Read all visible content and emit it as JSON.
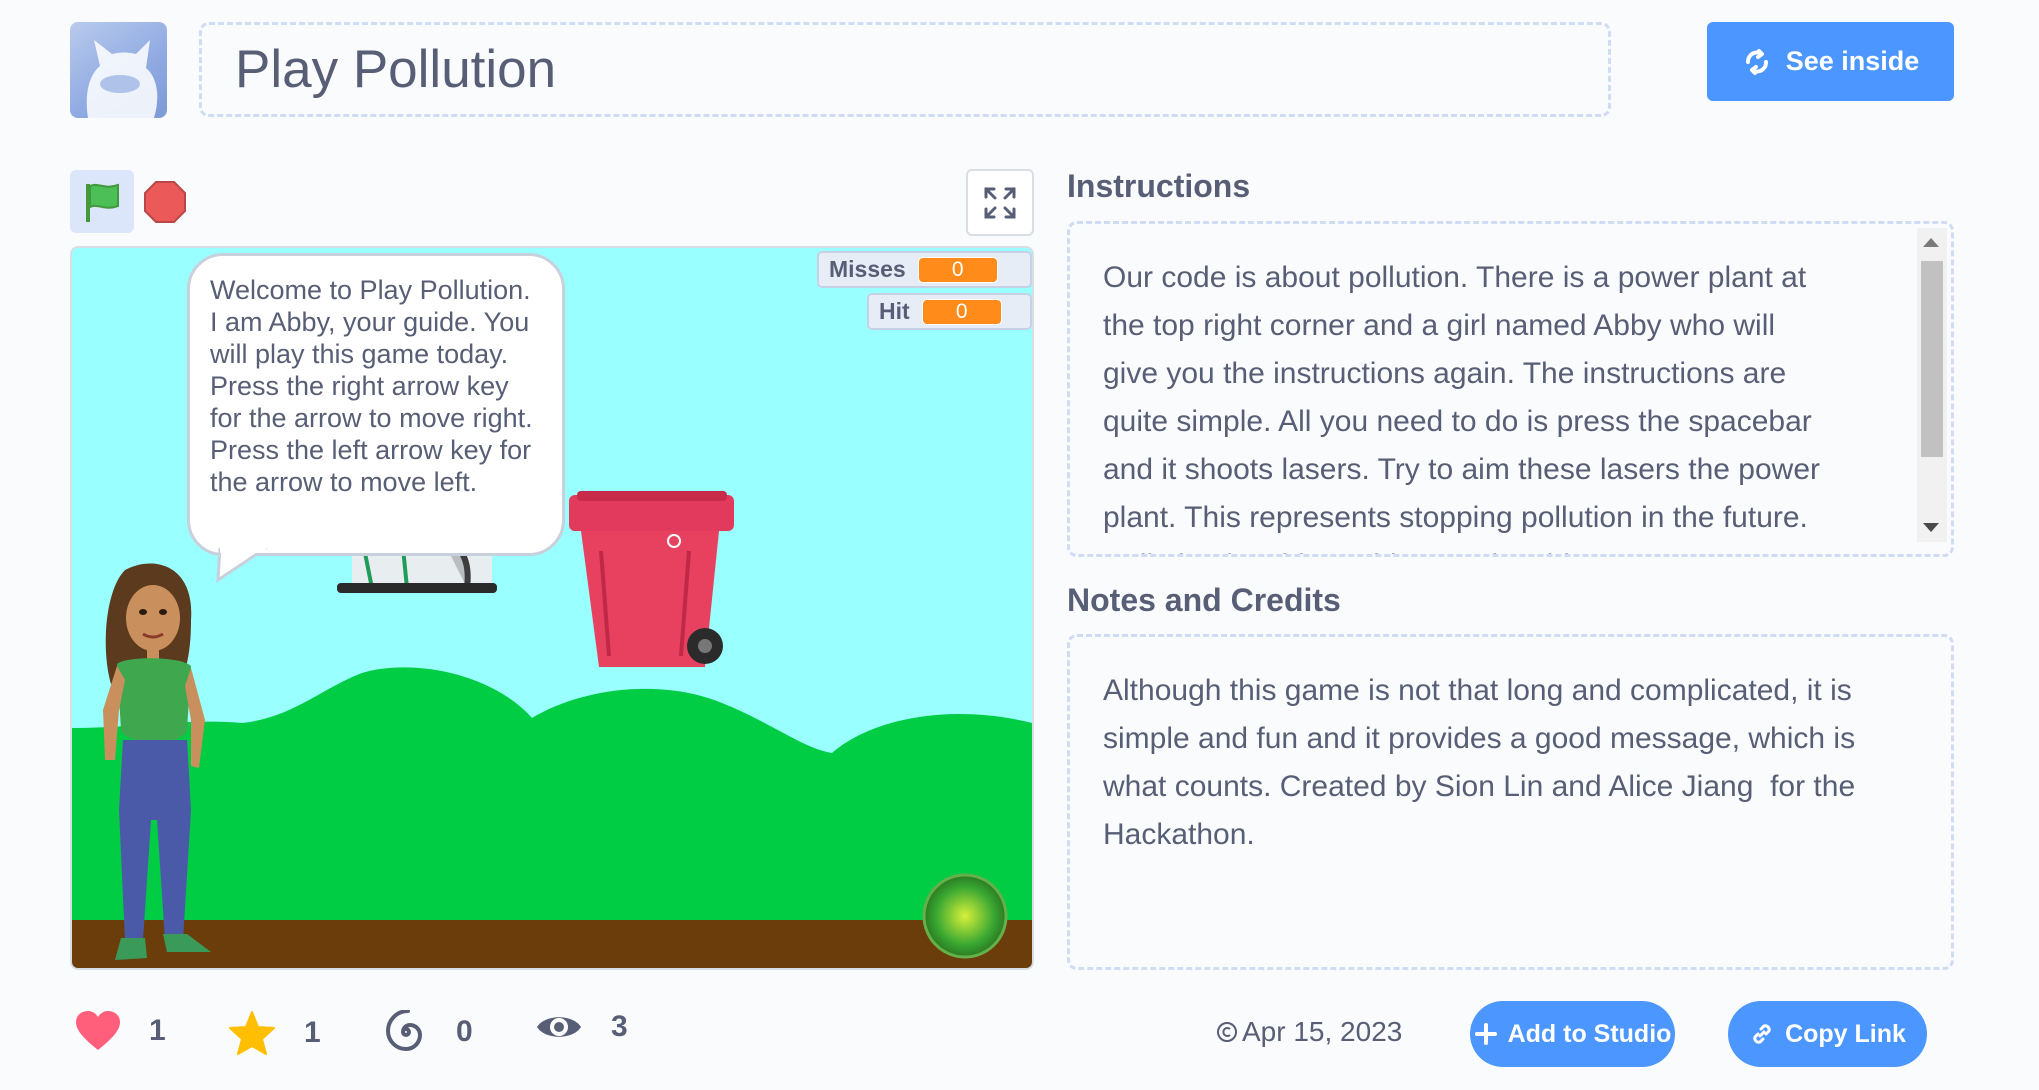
{
  "header": {
    "title": "Play Pollution",
    "see_inside_label": "See inside"
  },
  "stage": {
    "monitors": [
      {
        "label": "Misses",
        "value": "0"
      },
      {
        "label": "Hit",
        "value": "0"
      }
    ],
    "speech": "Welcome to Play Pollution. I am  Abby, your guide. You will play this game today. Press the right arrow key for the arrow to move right. Press the left arrow key for the arrow to move left."
  },
  "instructions": {
    "heading": "Instructions",
    "text": "Our code is about pollution. There is a power plant at\nthe top right corner and a girl named Abby who will\ngive you the instructions again. The instructions are\nquite simple. All you need to do is press the spacebar\nand it shoots lasers. Try to aim these lasers the power\nplant. This represents stopping pollution in the future.\nPollution is a big problem! Enjoy this game."
  },
  "notes": {
    "heading": "Notes and Credits",
    "text": "Although this game is not that long and complicated, it is\nsimple and fun and it provides a good message, which is\nwhat counts. Created by Sion Lin and Alice Jiang  for the\nHackathon."
  },
  "stats": {
    "loves": "1",
    "favorites": "1",
    "remixes": "0",
    "views": "3"
  },
  "footer": {
    "date": "Apr 15, 2023",
    "add_to_studio_label": "Add to Studio",
    "copy_link_label": "Copy Link"
  },
  "colors": {
    "accent": "#4c97ff",
    "monitor_value": "#ff8c1a",
    "love": "#ff5f7b",
    "favorite": "#ffbf00"
  }
}
